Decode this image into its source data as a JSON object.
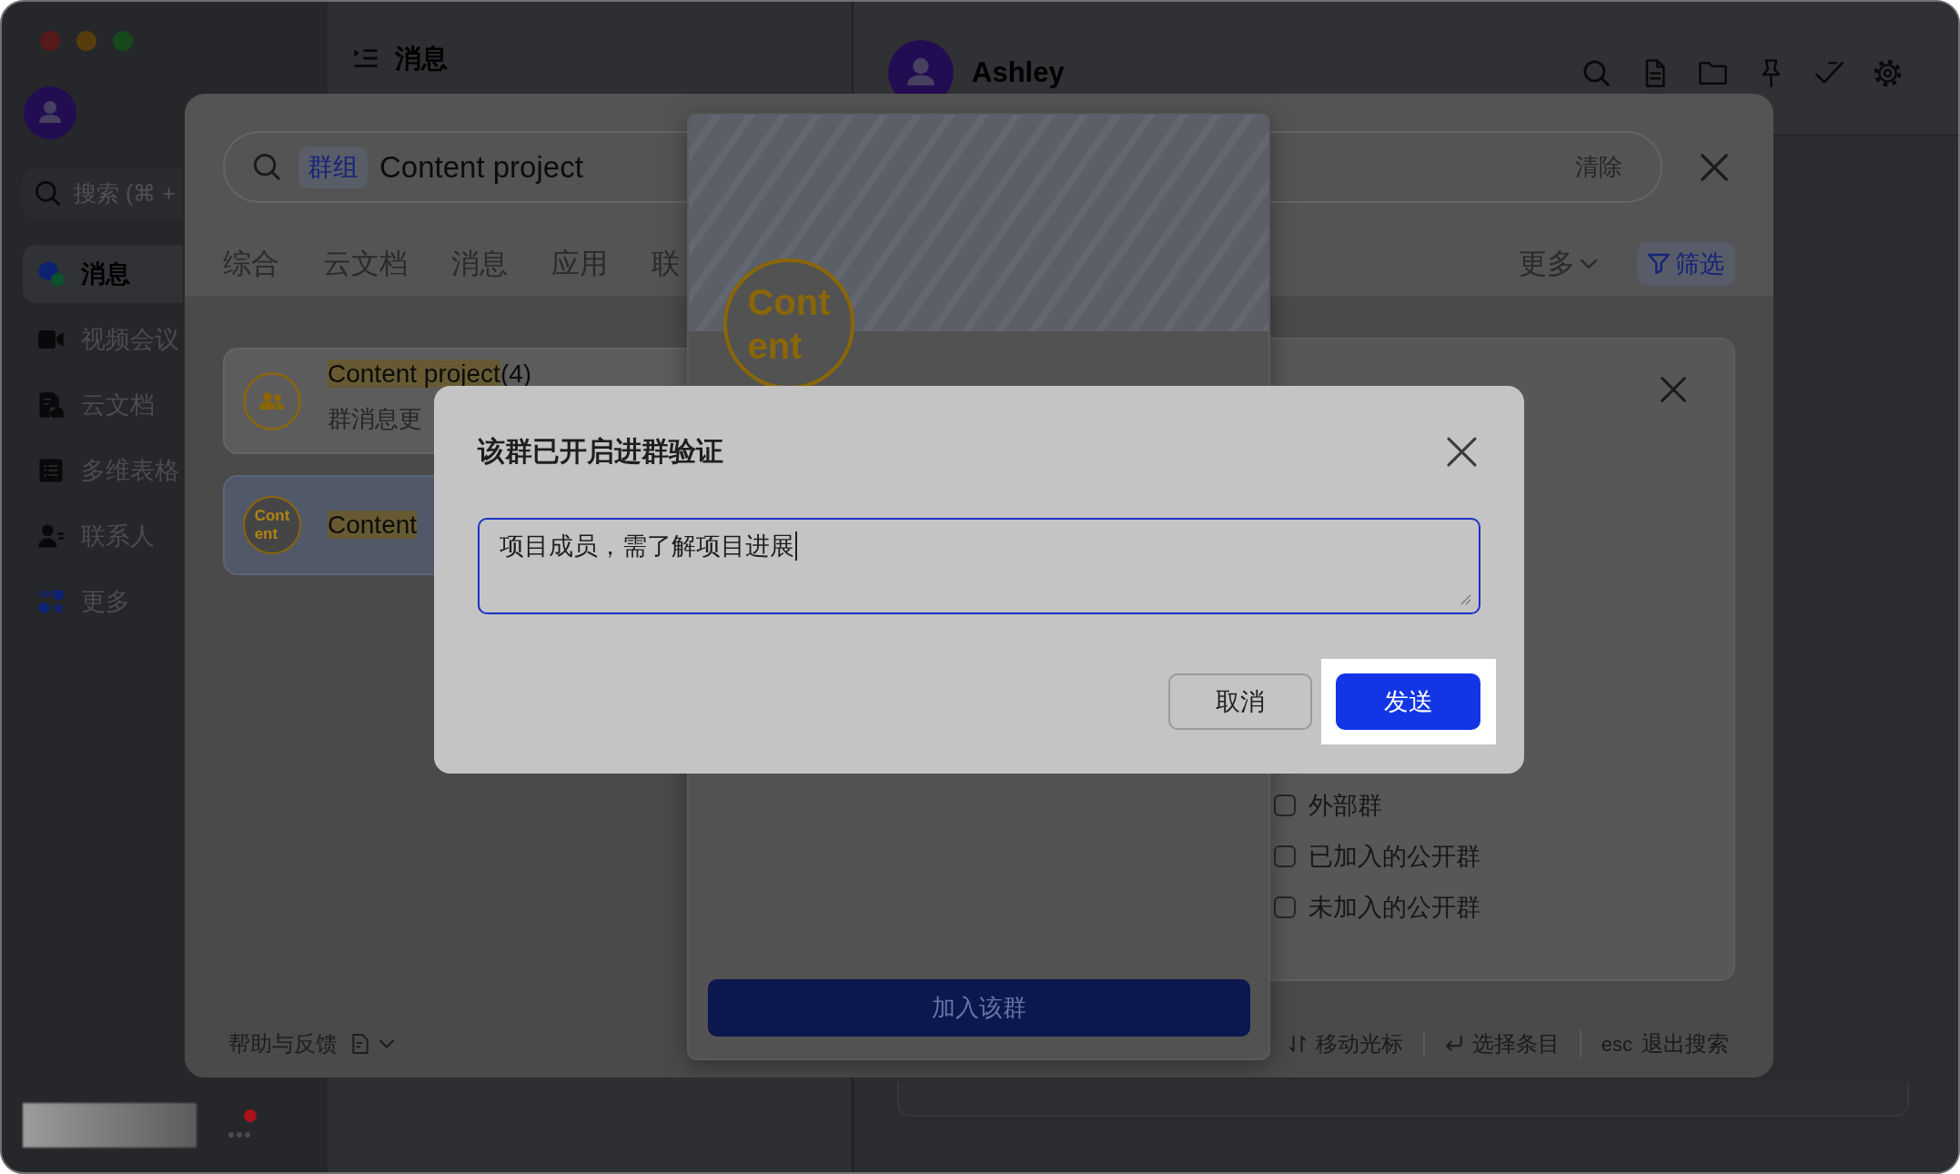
{
  "sidebar": {
    "search": {
      "placeholder": "搜索 (⌘ +"
    },
    "items": [
      {
        "label": "消息",
        "selected": true
      },
      {
        "label": "视频会议",
        "selected": false
      },
      {
        "label": "云文档",
        "selected": false
      },
      {
        "label": "多维表格",
        "selected": false
      },
      {
        "label": "联系人",
        "selected": false
      },
      {
        "label": "更多",
        "selected": false
      }
    ]
  },
  "chat_list": {
    "title": "消息"
  },
  "chat": {
    "title": "Ashley"
  },
  "search_panel": {
    "search": {
      "scope_tag": "群组",
      "value": "Content project",
      "clear_label": "清除"
    },
    "tabs": [
      {
        "label": "综合",
        "selected": false
      },
      {
        "label": "云文档",
        "selected": false
      },
      {
        "label": "消息",
        "selected": false
      },
      {
        "label": "应用",
        "selected": false
      },
      {
        "label": "联",
        "selected": false
      }
    ],
    "more_tab": "更多",
    "filter_button": "筛选",
    "results": [
      {
        "kind": "group",
        "title": [
          {
            "text": "Content",
            "highlighted": true
          },
          {
            "text": " project",
            "highlighted": true
          },
          {
            "text": "(4)",
            "highlighted": false
          }
        ],
        "subtitle": "群消息更",
        "selected": false
      },
      {
        "kind": "text",
        "avatar_lines": [
          "Cont",
          "ent"
        ],
        "title": [
          {
            "text": "Content",
            "highlighted": true
          }
        ],
        "selected": true
      }
    ],
    "group_card": {
      "avatar_lines": [
        "Cont",
        "ent"
      ],
      "join_button": "加入该群"
    },
    "filter_panel": {
      "options": [
        {
          "label": "外部群",
          "checked": false
        },
        {
          "label": "已加入的公开群",
          "checked": false
        },
        {
          "label": "未加入的公开群",
          "checked": false
        }
      ]
    },
    "footer": {
      "help": "帮助与反馈",
      "hints": [
        {
          "kind": "updown",
          "label": "移动光标"
        },
        {
          "kind": "enter",
          "label": "选择条目"
        },
        {
          "kind": "key",
          "key": "esc",
          "label": "退出搜索"
        }
      ]
    }
  },
  "dialog": {
    "title": "该群已开启进群验证",
    "message": "项目成员，需了解项目进展",
    "buttons": [
      {
        "label": "取消",
        "kind": "secondary",
        "highlighted": false
      },
      {
        "label": "发送",
        "kind": "primary",
        "highlighted": true
      }
    ]
  }
}
